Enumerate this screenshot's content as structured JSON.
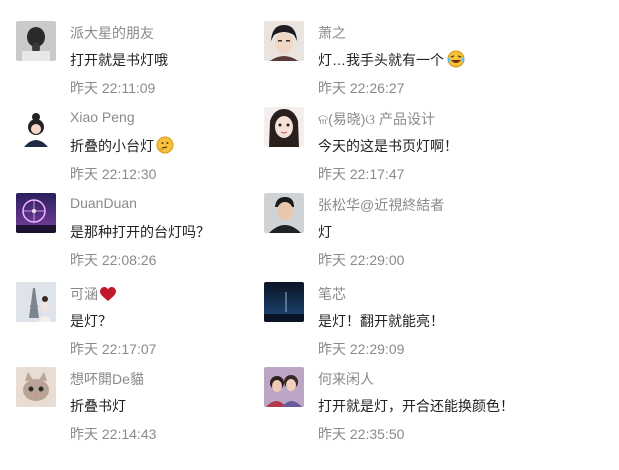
{
  "comments": [
    {
      "name": "派大星的朋友",
      "text": "打开就是书灯哦",
      "time": "昨天 22:11:09",
      "avatar": "girl-back-avatar"
    },
    {
      "name": "萧之",
      "text": "灯…我手头就有一个",
      "emoji": "laughing-emoji",
      "time": "昨天 22:26:27",
      "avatar": "anime-man-avatar"
    },
    {
      "name": "Xiao Peng",
      "text": "折叠的小台灯",
      "emoji": "thinking-emoji",
      "time": "昨天 22:12:30",
      "avatar": "cartoon-girl-avatar"
    },
    {
      "name": "ଳ(易晓)ଓ 产品设计",
      "text": "今天的这是书页灯啊！",
      "time": "昨天 22:17:47",
      "avatar": "girl-face-avatar"
    },
    {
      "name": "DuanDuan",
      "text": "是那种打开的台灯吗？",
      "time": "昨天 22:08:26",
      "avatar": "ferris-wheel-avatar"
    },
    {
      "name": "张松华@近視終結者",
      "text": "灯",
      "time": "昨天 22:29:00",
      "avatar": "man-avatar"
    },
    {
      "name": "可涵",
      "emoji_after_name": "heart-emoji",
      "text": "是灯？",
      "time": "昨天 22:17:07",
      "avatar": "eiffel-tower-avatar"
    },
    {
      "name": "笔芯",
      "text": "是灯！翻开就能亮！",
      "time": "昨天 22:29:09",
      "avatar": "night-scene-avatar"
    },
    {
      "name": "想吥閞De貓",
      "text": "折叠书灯",
      "time": "昨天 22:14:43",
      "avatar": "cat-avatar"
    },
    {
      "name": "何来闲人",
      "text": "打开就是灯，开合还能换颜色！",
      "time": "昨天 22:35:50",
      "avatar": "couple-avatar"
    }
  ],
  "colors": {
    "name": "#8a8a8a",
    "text": "#222222",
    "time": "#8a8a8a"
  }
}
